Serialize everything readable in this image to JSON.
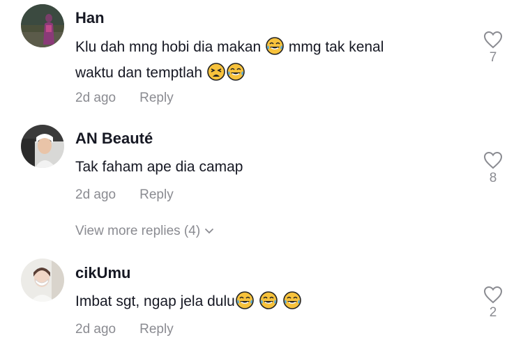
{
  "comments": [
    {
      "username": "Han",
      "text_1": "Klu dah mng hobi dia makan ",
      "text_2": " mmg tak kenal",
      "text_3": "waktu dan temptlah ",
      "time": "2d ago",
      "reply": "Reply",
      "likes": "7",
      "avatar_icon": "user-photo-avatar"
    },
    {
      "username": "AN Beauté",
      "text": "Tak faham ape dia camap",
      "time": "2d ago",
      "reply": "Reply",
      "likes": "8",
      "avatar_icon": "user-photo-avatar"
    },
    {
      "username": "cikUmu",
      "text": "Imbat sgt, ngap jela dulu",
      "time": "2d ago",
      "reply": "Reply",
      "likes": "2",
      "avatar_icon": "user-photo-avatar"
    }
  ],
  "view_more": "View more replies (4)",
  "icons": {
    "like": "heart-outline-icon",
    "expand": "chevron-down-icon",
    "laugh": "face-with-tears-of-joy-emoji",
    "weary": "weary-face-emoji"
  },
  "colors": {
    "text": "#161823",
    "secondary": "#8a8b91",
    "emoji_yellow": "#f7c23c"
  }
}
